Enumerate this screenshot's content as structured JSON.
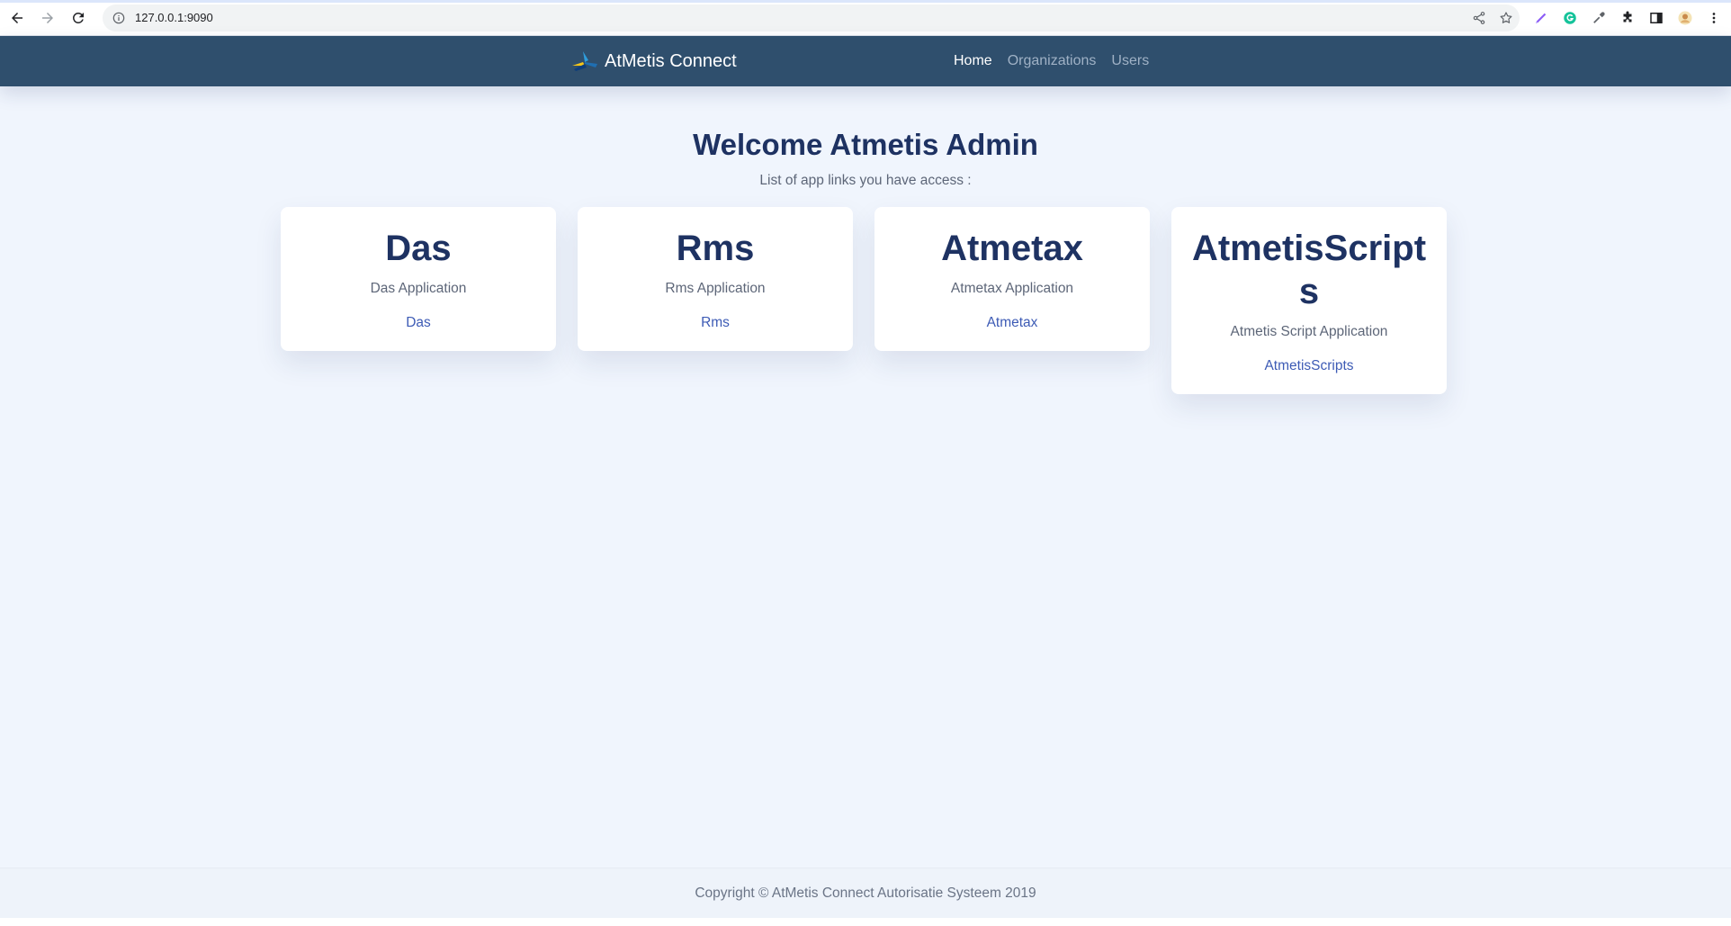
{
  "browser": {
    "url": "127.0.0.1:9090",
    "icons": {
      "back": "arrow-left-icon",
      "forward": "arrow-right-icon",
      "reload": "reload-icon",
      "info": "info-icon",
      "share": "share-icon",
      "bookmark": "star-icon",
      "extensions": [
        "pen-extension-icon",
        "grammarly-icon",
        "eyedropper-icon",
        "puzzle-icon",
        "sidepanel-icon",
        "profile-avatar",
        "more-vertical-icon"
      ]
    }
  },
  "header": {
    "brand": "AtMetis Connect",
    "nav": [
      {
        "label": "Home",
        "active": true
      },
      {
        "label": "Organizations",
        "active": false
      },
      {
        "label": "Users",
        "active": false
      }
    ]
  },
  "main": {
    "title": "Welcome Atmetis Admin",
    "subtitle": "List of app links you have access :",
    "cards": [
      {
        "title": "Das",
        "description": "Das Application",
        "link": "Das"
      },
      {
        "title": "Rms",
        "description": "Rms Application",
        "link": "Rms"
      },
      {
        "title": "Atmetax",
        "description": "Atmetax Application",
        "link": "Atmetax"
      },
      {
        "title": "AtmetisScripts",
        "description": "Atmetis Script Application",
        "link": "AtmetisScripts"
      }
    ]
  },
  "footer": {
    "text": "Copyright © AtMetis Connect Autorisatie Systeem 2019"
  },
  "colors": {
    "header_bg": "#2f4f6d",
    "page_bg": "#f0f5fd",
    "title": "#1e3262",
    "link": "#3d5bb5"
  }
}
